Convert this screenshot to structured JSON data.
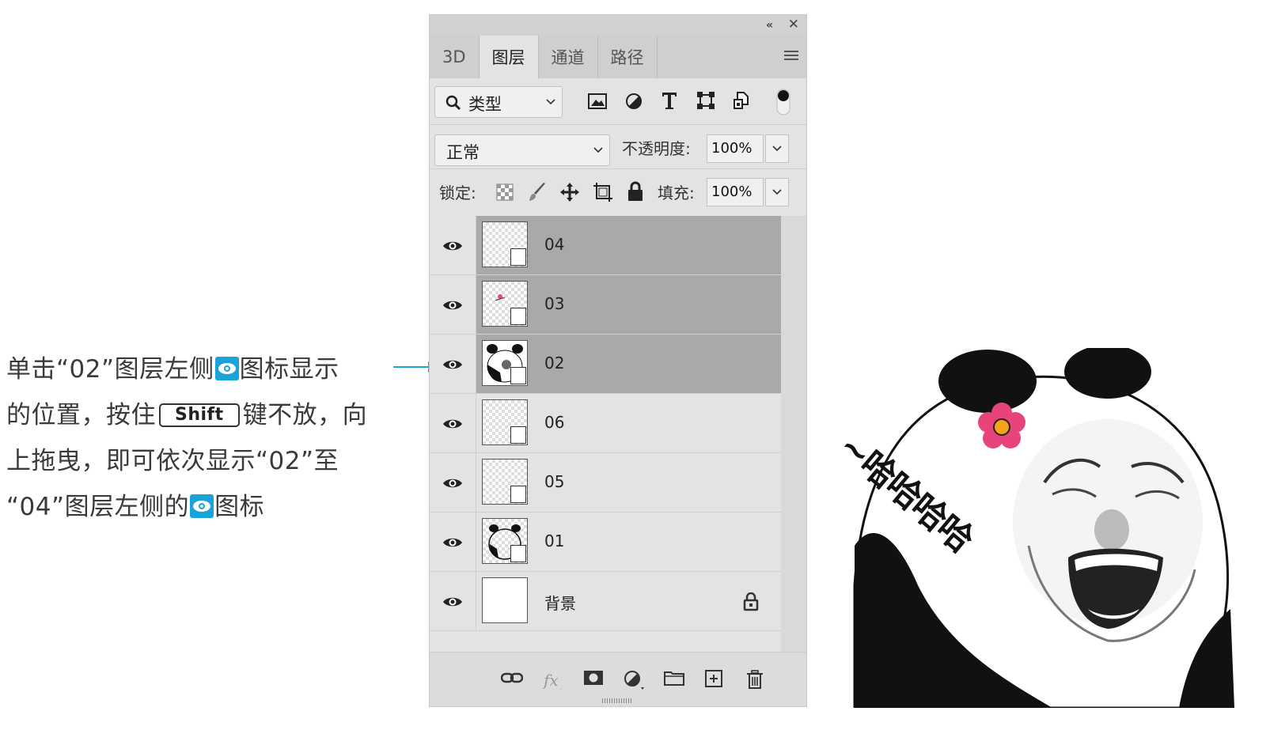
{
  "caption": {
    "line1_a": "单击“02”图层左侧",
    "line1_b": "图标显示",
    "line2_a": "的位置，按住",
    "line2_key": "Shift",
    "line2_b": "键不放，向",
    "line3": "上拖曳，即可依次显示“02”至",
    "line4_a": "“04”图层左侧的",
    "line4_b": "图标"
  },
  "panel": {
    "tabs": [
      {
        "label": "3D",
        "active": false
      },
      {
        "label": "图层",
        "active": true
      },
      {
        "label": "通道",
        "active": false
      },
      {
        "label": "路径",
        "active": false
      }
    ],
    "filter": {
      "kind_label": "类型"
    },
    "blend": {
      "mode": "正常",
      "opacity_label": "不透明度:",
      "opacity_value": "100%"
    },
    "lock": {
      "lock_label": "锁定:",
      "fill_label": "填充:",
      "fill_value": "100%"
    },
    "layers": [
      {
        "name": "04",
        "selected": true,
        "visible": true,
        "thumb": "transparent"
      },
      {
        "name": "03",
        "selected": true,
        "visible": true,
        "thumb": "transparent-red"
      },
      {
        "name": "02",
        "selected": true,
        "visible": true,
        "thumb": "panda"
      },
      {
        "name": "06",
        "selected": false,
        "visible": true,
        "thumb": "transparent"
      },
      {
        "name": "05",
        "selected": false,
        "visible": true,
        "thumb": "transparent"
      },
      {
        "name": "01",
        "selected": false,
        "visible": true,
        "thumb": "panda-outline"
      },
      {
        "name": "背景",
        "selected": false,
        "visible": true,
        "thumb": "white",
        "locked": true
      }
    ]
  },
  "meme": {
    "text": "~哈哈哈哈"
  },
  "colors": {
    "accent_blue": "#1aa3d9",
    "selected_layer": "#a9a9ab",
    "panel_bg": "#e3e3e3",
    "flower_pink": "#e8447a"
  }
}
